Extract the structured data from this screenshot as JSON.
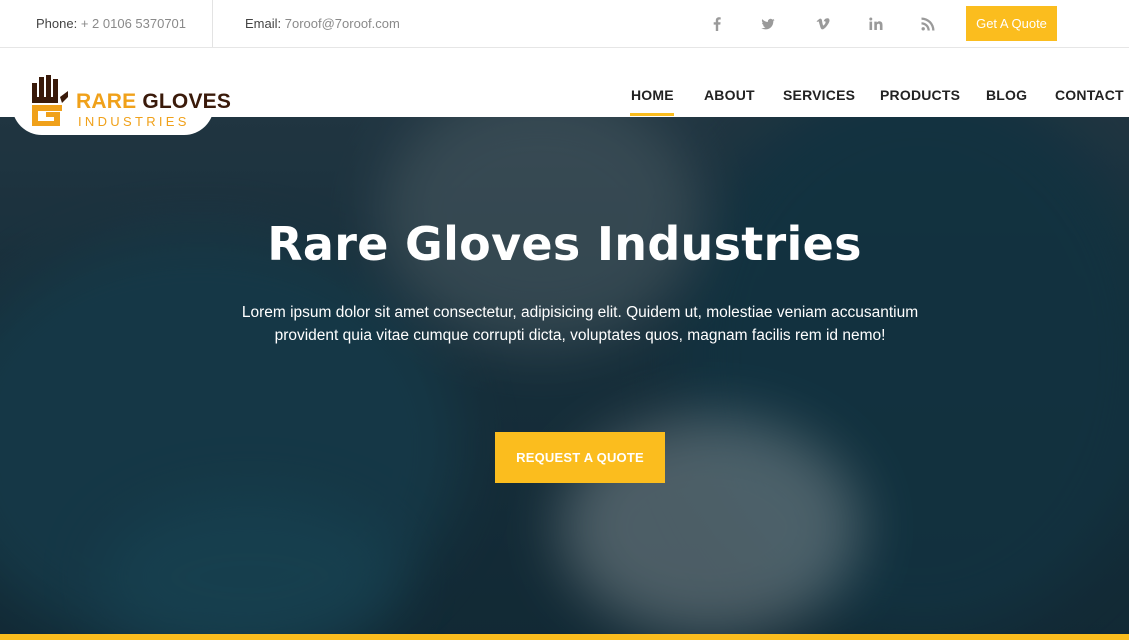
{
  "topbar": {
    "phone_label": "Phone:",
    "phone_value": "+ 2 0106 5370701",
    "email_label": "Email:",
    "email_value": "7oroof@7oroof.com",
    "social_icons": [
      "facebook-icon",
      "twitter-icon",
      "vimeo-icon",
      "linkedin-icon",
      "rss-icon"
    ],
    "quote_label": "Get A Quote"
  },
  "logo": {
    "word1": "RARE",
    "word2": "GLOVES",
    "tagline": "INDUSTRIES"
  },
  "nav": {
    "items": [
      "HOME",
      "ABOUT",
      "SERVICES",
      "PRODUCTS",
      "BLOG",
      "CONTACT"
    ],
    "active": "HOME"
  },
  "hero": {
    "title": "Rare Gloves Industries",
    "text": "Lorem ipsum dolor sit amet consectetur, adipisicing elit. Quidem ut, molestiae veniam accusantium provident quia vitae cumque corrupti dicta, voluptates quos, magnam facilis rem id nemo!",
    "button_label": "REQUEST A QUOTE"
  },
  "colors": {
    "accent": "#fbbd1e",
    "logo_dark": "#3a1a0a",
    "logo_orange": "#f0a11a"
  }
}
